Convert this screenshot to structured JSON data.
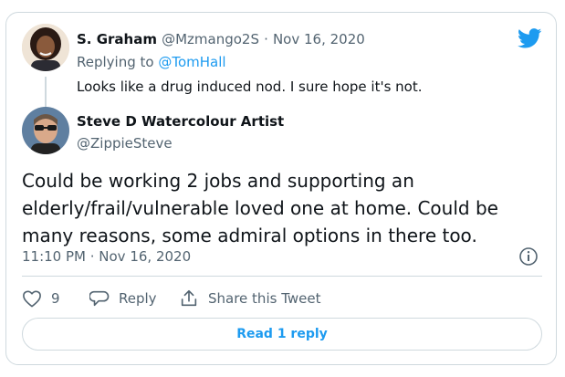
{
  "reply_tweet": {
    "author_name": "S. Graham",
    "author_handle": "@Mzmango2S",
    "separator": "·",
    "date": "Nov 16, 2020",
    "replying_to_prefix": "Replying to",
    "replying_to_handle": "@TomHall",
    "text": "Looks like a drug induced nod. I sure hope it's not."
  },
  "main_tweet": {
    "author_name": "Steve D Watercolour Artist",
    "author_handle": "@ZippieSteve",
    "text": "Could be working 2 jobs and supporting an elderly/frail/vulnerable loved one at home. Could be many reasons, some admiral options in there too.",
    "timestamp": "11:10 PM · Nov 16, 2020"
  },
  "actions": {
    "like_count": "9",
    "reply_label": "Reply",
    "share_label": "Share this Tweet"
  },
  "read_replies_label": "Read 1 reply",
  "icons": {
    "logo": "twitter-bird-icon",
    "info": "info-icon",
    "like": "heart-icon",
    "reply": "speech-bubble-icon",
    "share": "share-upload-icon"
  },
  "colors": {
    "brand_blue": "#1d9bf0",
    "text_primary": "#0f1419",
    "text_secondary": "#536471",
    "border": "#cfd9de"
  }
}
